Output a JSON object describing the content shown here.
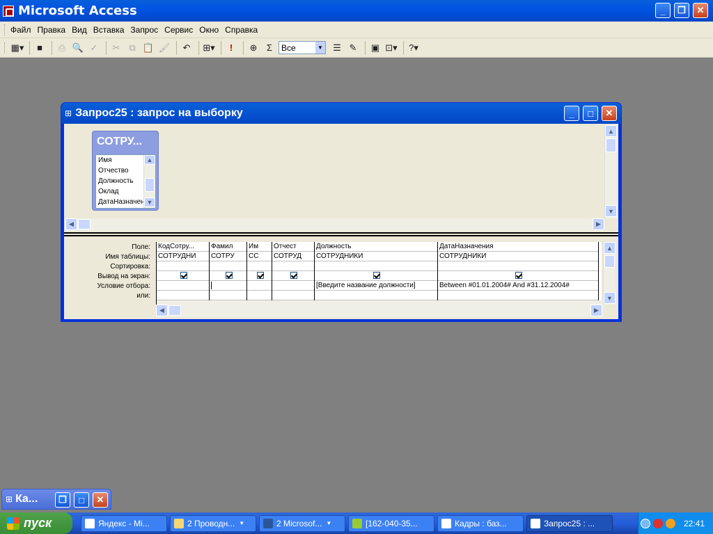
{
  "app": {
    "title": "Microsoft Access"
  },
  "menu": [
    "Файл",
    "Правка",
    "Вид",
    "Вставка",
    "Запрос",
    "Сервис",
    "Окно",
    "Справка"
  ],
  "toolbar": {
    "combo_value": "Все",
    "sigma": "Σ",
    "run": "!"
  },
  "query_window": {
    "title": "Запрос25 : запрос на выборку",
    "table_box": {
      "title": "СОТРУ...",
      "fields": [
        "Имя",
        "Отчество",
        "Должность",
        "Оклад",
        "ДатаНазначения"
      ]
    },
    "row_labels": [
      "Поле:",
      "Имя таблицы:",
      "Сортировка:",
      "Вывод на экран:",
      "Условие отбора:",
      "или:"
    ],
    "columns": [
      {
        "field": "КодСотру...",
        "table": "СОТРУДНИ",
        "show": true,
        "criteria": ""
      },
      {
        "field": "Фамил",
        "table": "СОТРУ",
        "show": true,
        "criteria": ""
      },
      {
        "field": "Им",
        "table": "СС",
        "show": true,
        "criteria": ""
      },
      {
        "field": "Отчест",
        "table": "СОТРУД",
        "show": true,
        "criteria": ""
      },
      {
        "field": "Должность",
        "table": "СОТРУДНИКИ",
        "show": true,
        "criteria": "[Введите название должности]"
      },
      {
        "field": "ДатаНазначения",
        "table": "СОТРУДНИКИ",
        "show": true,
        "criteria": "Between #01.01.2004# And #31.12.2004#"
      }
    ]
  },
  "minimized_window": {
    "title": "Ка..."
  },
  "taskbar": {
    "start_label": "пуск",
    "tasks": [
      "Яндекс - Mi...",
      "2 Проводн...",
      "2 Microsof...",
      "[162-040-35...",
      "Кадры : баз...",
      "Запрос25 : ..."
    ],
    "clock": "22:41"
  }
}
